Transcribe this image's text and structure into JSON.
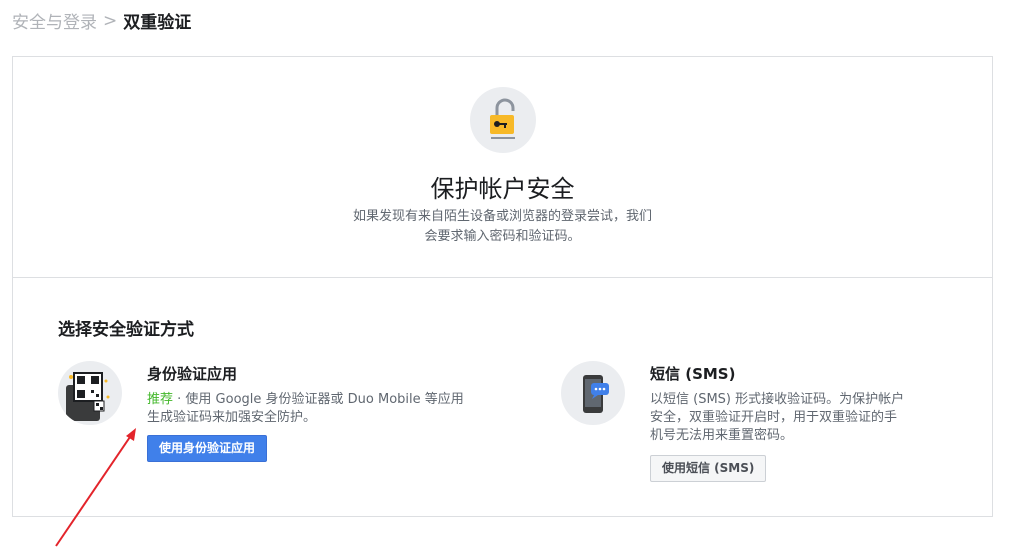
{
  "breadcrumb": {
    "parent": "安全与登录",
    "separator": ">",
    "current": "双重验证"
  },
  "hero": {
    "title": "保护帐户安全",
    "desc_line1": "如果发现有来自陌生设备或浏览器的登录尝试，我们",
    "desc_line2": "会要求输入密码和验证码。"
  },
  "methods_section": {
    "title": "选择安全验证方式",
    "auth_app": {
      "icon": "authenticator-qr-icon",
      "name": "身份验证应用",
      "recommended": "推荐",
      "desc_line1_rest": " · 使用 Google 身份验证器或 Duo Mobile 等应用",
      "desc_line2": "生成验证码来加强安全防护。",
      "button": "使用身份验证应用"
    },
    "sms": {
      "icon": "phone-sms-icon",
      "name": "短信 (SMS)",
      "desc_line1": "以短信 (SMS) 形式接收验证码。为保护帐户",
      "desc_line2": "安全，双重验证开启时，用于双重验证的手",
      "desc_line3": "机号无法用来重置密码。",
      "button": "使用短信 (SMS)"
    }
  },
  "colors": {
    "primary_button": "#4080ea",
    "recommended_text": "#42b72a",
    "annotation_arrow": "#e3242b"
  }
}
